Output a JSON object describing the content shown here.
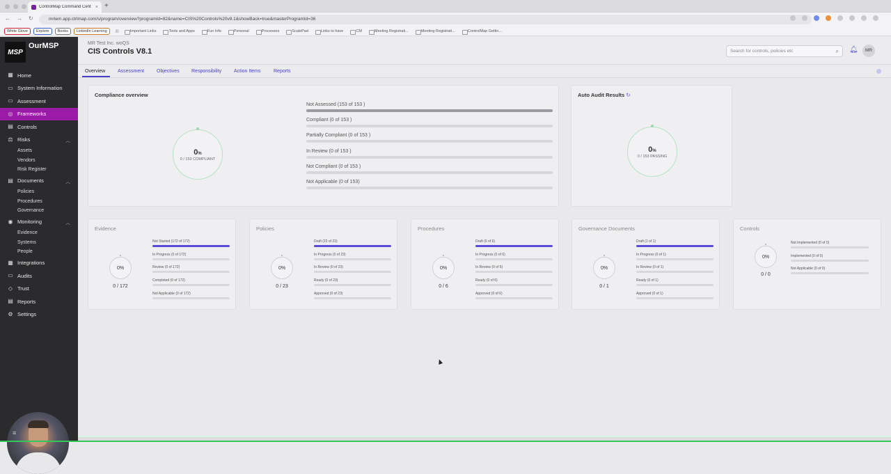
{
  "browser": {
    "tab_title": "ControlMap Command Cent",
    "url": "mrtem.app.ctrlmap.com/s/program/overview?programId=82&name=CIS%20Controls%20v8.1&showBack=true&masterProgramId=36",
    "bookmarks_pills": [
      {
        "label": "White Glove",
        "color": "#cc2233"
      },
      {
        "label": "Explore",
        "color": "#3a62c9"
      },
      {
        "label": "Books",
        "color": "#777777"
      },
      {
        "label": "LinkedIn Learning",
        "color": "#c8782a"
      }
    ],
    "bookmarks_folders": [
      "Important Links",
      "Tools and Apps",
      "Fun Info",
      "Personal",
      "Processes",
      "ScalePad",
      "Links to have",
      "CM",
      "Meeting Registrati...",
      "Meeting Registrati...",
      "ControlMap Gettin..."
    ]
  },
  "sidebar": {
    "brand": "OurMSP",
    "logo_text": "MSP",
    "items": [
      {
        "label": "Home",
        "icon": "grid-icon",
        "glyph": "▦"
      },
      {
        "label": "System Information",
        "icon": "info-icon",
        "glyph": "▭"
      },
      {
        "label": "Assessment",
        "icon": "clipboard-icon",
        "glyph": "▭"
      },
      {
        "label": "Frameworks",
        "icon": "frameworks-icon",
        "glyph": "◎",
        "active": true
      },
      {
        "label": "Controls",
        "icon": "controls-icon",
        "glyph": "▤"
      },
      {
        "label": "Risks",
        "icon": "risk-icon",
        "glyph": "⚖"
      },
      {
        "label": "Assets"
      },
      {
        "label": "Vendors"
      },
      {
        "label": "Risk Register"
      },
      {
        "label": "Documents",
        "icon": "document-icon",
        "glyph": "▤"
      },
      {
        "label": "Policies"
      },
      {
        "label": "Procedures"
      },
      {
        "label": "Governance"
      },
      {
        "label": "Monitoring",
        "icon": "monitoring-icon",
        "glyph": "◉"
      },
      {
        "label": "Evidence"
      },
      {
        "label": "Systems"
      },
      {
        "label": "People"
      },
      {
        "label": "Integrations",
        "icon": "integrations-icon",
        "glyph": "▦"
      },
      {
        "label": "Audits",
        "icon": "audit-icon",
        "glyph": "▭"
      },
      {
        "label": "Trust",
        "icon": "trust-icon",
        "glyph": "◇"
      },
      {
        "label": "Reports",
        "icon": "reports-icon",
        "glyph": "▤"
      },
      {
        "label": "Settings",
        "icon": "gear-icon",
        "glyph": "⚙"
      }
    ]
  },
  "header": {
    "org": "MR Test Inc. woQS",
    "title": "CIS Controls V8.1",
    "search_placeholder": "Search for controls, policies etc",
    "avatar": "MR"
  },
  "tabs": [
    "Overview",
    "Assessment",
    "Objectives",
    "Responsibility",
    "Action Items",
    "Reports"
  ],
  "compliance": {
    "title": "Compliance overview",
    "pct": "0",
    "pct_unit": "%",
    "sub": "0 / 153 COMPLIANT",
    "rows": [
      {
        "label": "Not Assessed (153 of 153 )",
        "fraction": 1.0
      },
      {
        "label": "Compliant (0 of 153 )",
        "fraction": 0
      },
      {
        "label": "Partially Compliant (0 of 153 )",
        "fraction": 0
      },
      {
        "label": "In Review (0 of 153 )",
        "fraction": 0
      },
      {
        "label": "Not Compliant (0 of 153 )",
        "fraction": 0
      },
      {
        "label": "Not Applicable (0 of 153)",
        "fraction": 0
      }
    ]
  },
  "audit": {
    "title": "Auto Audit Results",
    "pct": "0",
    "pct_unit": "%",
    "sub": "0 / 153 PASSING"
  },
  "small_cards": [
    {
      "title": "Evidence",
      "pct": "0%",
      "count": "0 / 172",
      "rows": [
        {
          "label": "Not Started (172 of 172)",
          "fraction": 1
        },
        {
          "label": "In Progress (0 of 172)",
          "fraction": 0
        },
        {
          "label": "Review (0 of 172)",
          "fraction": 0
        },
        {
          "label": "Completed (0 of 172)",
          "fraction": 0
        },
        {
          "label": "Not Applicable (0 of 172)",
          "fraction": 0
        }
      ]
    },
    {
      "title": "Policies",
      "pct": "0%",
      "count": "0 / 23",
      "rows": [
        {
          "label": "Draft (23 of 23)",
          "fraction": 1
        },
        {
          "label": "In Progress (0 of 23)",
          "fraction": 0
        },
        {
          "label": "In Review (0 of 23)",
          "fraction": 0
        },
        {
          "label": "Ready (0 of 23)",
          "fraction": 0
        },
        {
          "label": "Approved (0 of 23)",
          "fraction": 0
        }
      ]
    },
    {
      "title": "Procedures",
      "pct": "0%",
      "count": "0 / 6",
      "rows": [
        {
          "label": "Draft (6 of 6)",
          "fraction": 1
        },
        {
          "label": "In Progress (0 of 6)",
          "fraction": 0
        },
        {
          "label": "In Review (0 of 6)",
          "fraction": 0
        },
        {
          "label": "Ready (0 of 6)",
          "fraction": 0
        },
        {
          "label": "Approved (0 of 6)",
          "fraction": 0
        }
      ]
    },
    {
      "title": "Governance Documents",
      "pct": "0%",
      "count": "0 / 1",
      "rows": [
        {
          "label": "Draft (1 of 1)",
          "fraction": 1
        },
        {
          "label": "In Progress (0 of 1)",
          "fraction": 0
        },
        {
          "label": "In Review (0 of 1)",
          "fraction": 0
        },
        {
          "label": "Ready (0 of 1)",
          "fraction": 0
        },
        {
          "label": "Approved (0 of 1)",
          "fraction": 0
        }
      ]
    },
    {
      "title": "Controls",
      "pct": "0%",
      "count": "0 / 0",
      "rows": [
        {
          "label": "Not Implemented (0 of 0)",
          "fraction": 0
        },
        {
          "label": "Implemented (0 of 0)",
          "fraction": 0
        },
        {
          "label": "Not Applicable (0 of 0)",
          "fraction": 0
        }
      ]
    }
  ],
  "colors": {
    "accent": "#9c1aa8",
    "link": "#4a3fc4",
    "progress": "#5b4bd6"
  }
}
